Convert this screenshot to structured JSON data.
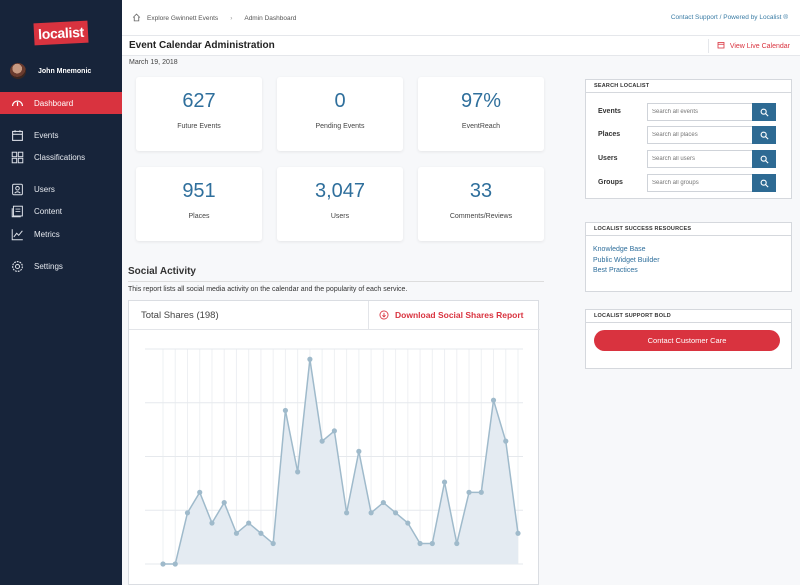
{
  "sidebar": {
    "logo_text": "localist",
    "user_name": "John Mnemonic",
    "items": [
      {
        "label": "Dashboard",
        "icon": "gauge-icon",
        "active": true
      },
      {
        "label": "Events",
        "icon": "calendar-icon"
      },
      {
        "label": "Classifications",
        "icon": "grid-icon"
      },
      {
        "label": "Users",
        "icon": "user-icon"
      },
      {
        "label": "Content",
        "icon": "content-icon"
      },
      {
        "label": "Metrics",
        "icon": "chart-line-icon"
      },
      {
        "label": "Settings",
        "icon": "gear-icon"
      }
    ]
  },
  "topbar": {
    "breadcrumb": [
      "Explore Gwinnett Events",
      "Admin Dashboard"
    ],
    "links": "Contact Support / Powered by Localist ®"
  },
  "header": {
    "title": "Event Calendar Administration",
    "view_live": "View Live Calendar",
    "date": "March 19, 2018"
  },
  "stats": [
    {
      "value": "627",
      "label": "Future Events"
    },
    {
      "value": "0",
      "label": "Pending Events"
    },
    {
      "value": "97%",
      "label": "EventReach"
    },
    {
      "value": "951",
      "label": "Places"
    },
    {
      "value": "3,047",
      "label": "Users"
    },
    {
      "value": "33",
      "label": "Comments/Reviews"
    }
  ],
  "social": {
    "title": "Social Activity",
    "description": "This report lists all social media activity on the calendar and the popularity of each service.",
    "total_shares": "Total Shares (198)",
    "download": "Download Social Shares Report"
  },
  "chart_data": {
    "type": "area",
    "title": "",
    "xlabel": "",
    "ylabel": "",
    "ylim": [
      0,
      21
    ],
    "grid": true,
    "series": [
      {
        "values": [
          0,
          0,
          5,
          7,
          4,
          6,
          3,
          4,
          3,
          2,
          15,
          9,
          20,
          12,
          13,
          5,
          11,
          5,
          6,
          5,
          4,
          2,
          2,
          8,
          2,
          7,
          7,
          16,
          12,
          3
        ]
      }
    ]
  },
  "search": {
    "title": "SEARCH LOCALIST",
    "rows": [
      {
        "label": "Events",
        "placeholder": "Search all events"
      },
      {
        "label": "Places",
        "placeholder": "Search all places"
      },
      {
        "label": "Users",
        "placeholder": "Search all users"
      },
      {
        "label": "Groups",
        "placeholder": "Search all groups"
      }
    ]
  },
  "resources": {
    "title": "LOCALIST SUCCESS RESOURCES",
    "links": [
      "Knowledge Base",
      "Public Widget Builder",
      "Best Practices"
    ]
  },
  "support": {
    "title": "LOCALIST SUPPORT BOLD",
    "button": "Contact Customer Care"
  },
  "colors": {
    "brand_red": "#d9333f",
    "sidebar_bg": "#17243a",
    "accent_blue": "#2f6f9c",
    "chart_line": "#9fbacb",
    "chart_fill": "#e4ebf2"
  }
}
